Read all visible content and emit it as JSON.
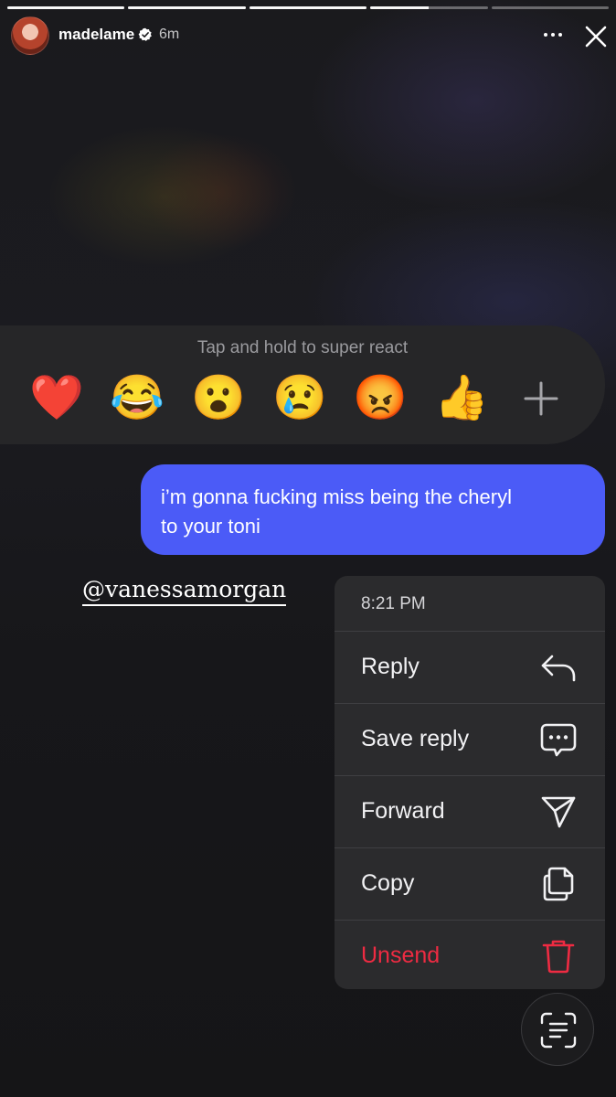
{
  "story": {
    "segments": [
      1,
      1,
      1,
      0.5,
      0
    ],
    "username": "madelame",
    "time_ago": "6m",
    "verified_icon": "verified-badge-icon",
    "more_icon": "more-options-icon",
    "close_icon": "close-icon"
  },
  "reactions": {
    "hint": "Tap and hold to super react",
    "emojis": [
      "❤️",
      "😂",
      "😮",
      "😢",
      "😡",
      "👍"
    ],
    "more_icon": "plus-icon"
  },
  "message": {
    "text_line1": "i’m gonna fucking miss being the cheryl",
    "text_line2": "to your toni",
    "bubble_color": "#4b5bf7"
  },
  "mention": "@vanessamorgan",
  "menu": {
    "time": "8:21 PM",
    "items": [
      {
        "label": "Reply",
        "icon": "reply-arrow-icon"
      },
      {
        "label": "Save reply",
        "icon": "speech-bubble-dots-icon"
      },
      {
        "label": "Forward",
        "icon": "paper-plane-icon"
      },
      {
        "label": "Copy",
        "icon": "copy-icon"
      },
      {
        "label": "Unsend",
        "icon": "trash-icon",
        "color": "#ee2b42"
      }
    ]
  },
  "scan_button_icon": "scan-text-icon"
}
